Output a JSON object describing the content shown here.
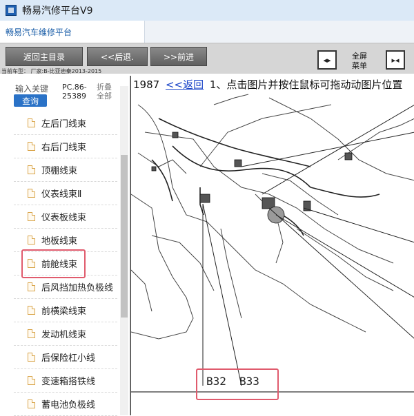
{
  "window": {
    "title": "畅易汽修平台V9",
    "tab_label": "畅易汽车维修平台"
  },
  "toolbar": {
    "back_main": "返回主目录",
    "prev": "<<后退.",
    "next": ">>前进",
    "fullscreen_line1": "全屏",
    "fullscreen_line2": "菜单"
  },
  "infoline": "当前车型： 厂家:B-比亚迪秦2013-2015",
  "left": {
    "search_label": "输入关键",
    "query_button": "查询",
    "code_line1": "PC.86-",
    "code_line2": "25389",
    "fold_line1": "折叠",
    "fold_line2": "全部",
    "items": [
      {
        "label": "左后门线束"
      },
      {
        "label": "右后门线束"
      },
      {
        "label": "顶棚线束"
      },
      {
        "label": "仪表线束Ⅱ"
      },
      {
        "label": "仪表板线束"
      },
      {
        "label": "地板线束"
      },
      {
        "label": "前舱线束"
      },
      {
        "label": "后风挡加热负极线"
      },
      {
        "label": "前横梁线束"
      },
      {
        "label": "发动机线束"
      },
      {
        "label": "后保险杠小线"
      },
      {
        "label": "变速箱搭铁线"
      },
      {
        "label": "蓄电池负极线"
      }
    ]
  },
  "right": {
    "page_number": "1987",
    "back_link": "<<返回",
    "instruction": "1、点击图片并按住鼠标可拖动动图片位置",
    "label_b32": "B32",
    "label_b33": "B33"
  },
  "colors": {
    "highlight": "#e05b6d",
    "link": "#1a44c8",
    "query_button": "#2a72c7"
  }
}
